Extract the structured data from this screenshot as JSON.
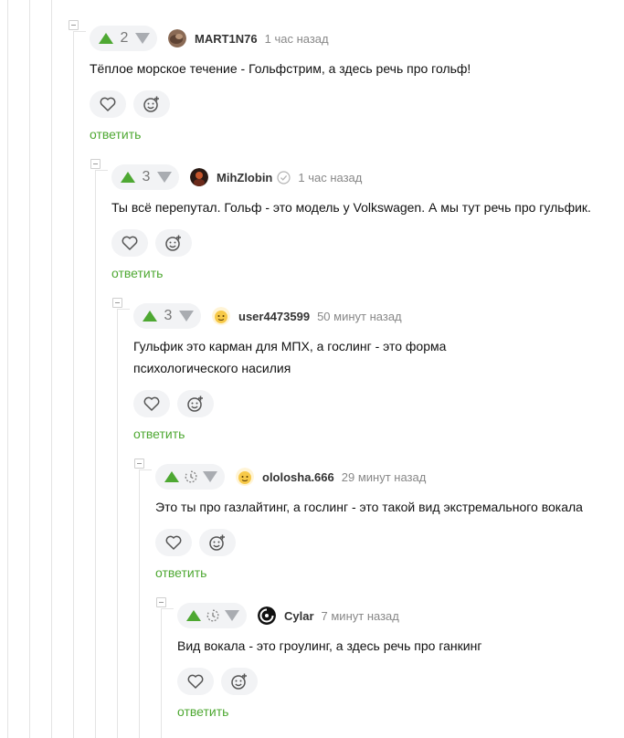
{
  "comments": [
    {
      "score": "2",
      "username": "MART1N76",
      "time": "1 час назад",
      "text_lines": [
        "Тёплое морское течение - Гольфстрим, а здесь речь про гольф!"
      ],
      "reply_label": "ответить",
      "avatar_icon": "avatar-photo-icon"
    },
    {
      "score": "3",
      "username": "MihZlobin",
      "verified": true,
      "time": "1 час назад",
      "text_lines": [
        "Ты всё перепутал. Гольф - это модель у Volkswagen. А мы тут речь про гульфик."
      ],
      "reply_label": "ответить",
      "avatar_icon": "avatar-photo-icon"
    },
    {
      "score": "3",
      "username": "user4473599",
      "time": "50 минут назад",
      "text_lines": [
        "Гульфик это карман для МПХ, а гослинг - это форма",
        "психологического насилия"
      ],
      "reply_label": "ответить",
      "avatar_icon": "avatar-emoji-icon"
    },
    {
      "score": "",
      "username": "ololosha.666",
      "time": "29 минут назад",
      "text_lines": [
        "Это ты про газлайтинг, а гослинг - это такой вид экстремального вокала"
      ],
      "reply_label": "ответить",
      "avatar_icon": "avatar-emoji-icon"
    },
    {
      "score": "",
      "username": "Cylar",
      "time": "7 минут назад",
      "text_lines": [
        "Вид вокала - это гроулинг, а здесь речь про ганкинг"
      ],
      "reply_label": "ответить",
      "avatar_icon": "avatar-logo-icon"
    }
  ],
  "colors": {
    "accent_green": "#4ea832",
    "vote_bg": "#f2f3f5",
    "downvote_grey": "#a9acb1"
  },
  "icons": {
    "upvote": "arrow-up-icon",
    "downvote": "arrow-down-icon",
    "pending_score": "clock-icon",
    "like": "heart-icon",
    "reaction": "add-reaction-icon",
    "verified": "verified-check-icon",
    "collapse": "collapse-thread-icon"
  }
}
